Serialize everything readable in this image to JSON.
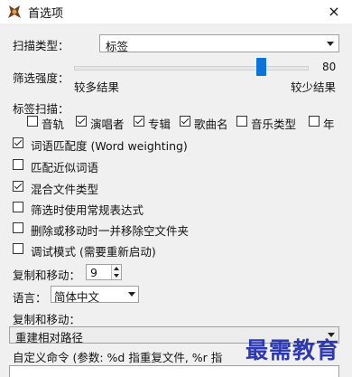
{
  "window": {
    "title": "首选项",
    "close_glyph": "×"
  },
  "scan_type": {
    "label": "扫描类型：",
    "value": "标签"
  },
  "filter_strength": {
    "label": "筛选强度：",
    "value": "80",
    "level": 80,
    "left_label": "较多结果",
    "right_label": "较少结果"
  },
  "tag_scan": {
    "label": "标签扫描：",
    "items": [
      {
        "label": "音轨",
        "checked": false
      },
      {
        "label": "演唱者",
        "checked": true
      },
      {
        "label": "专辑",
        "checked": true
      },
      {
        "label": "歌曲名",
        "checked": true
      },
      {
        "label": "音乐类型",
        "checked": false
      },
      {
        "label": "年",
        "checked": false
      }
    ]
  },
  "options": [
    {
      "label": "词语匹配度 (Word weighting)",
      "checked": true
    },
    {
      "label": "匹配近似词语",
      "checked": false
    },
    {
      "label": "混合文件类型",
      "checked": true
    },
    {
      "label": "筛选时使用常规表达式",
      "checked": false
    },
    {
      "label": "删除或移动时一并移除空文件夹",
      "checked": false
    },
    {
      "label": "调试模式 (需要重新启动)",
      "checked": false
    }
  ],
  "copy_move_count": {
    "label": "复制和移动：",
    "value": "9"
  },
  "language": {
    "label": "语言：",
    "value": "简体中文"
  },
  "copy_move_path": {
    "label": "复制和移动：",
    "value": "重建相对路径"
  },
  "custom_command": {
    "label": "自定义命令 (参数: %d 指重复文件, %r 指"
  },
  "watermark": "最需教育"
}
